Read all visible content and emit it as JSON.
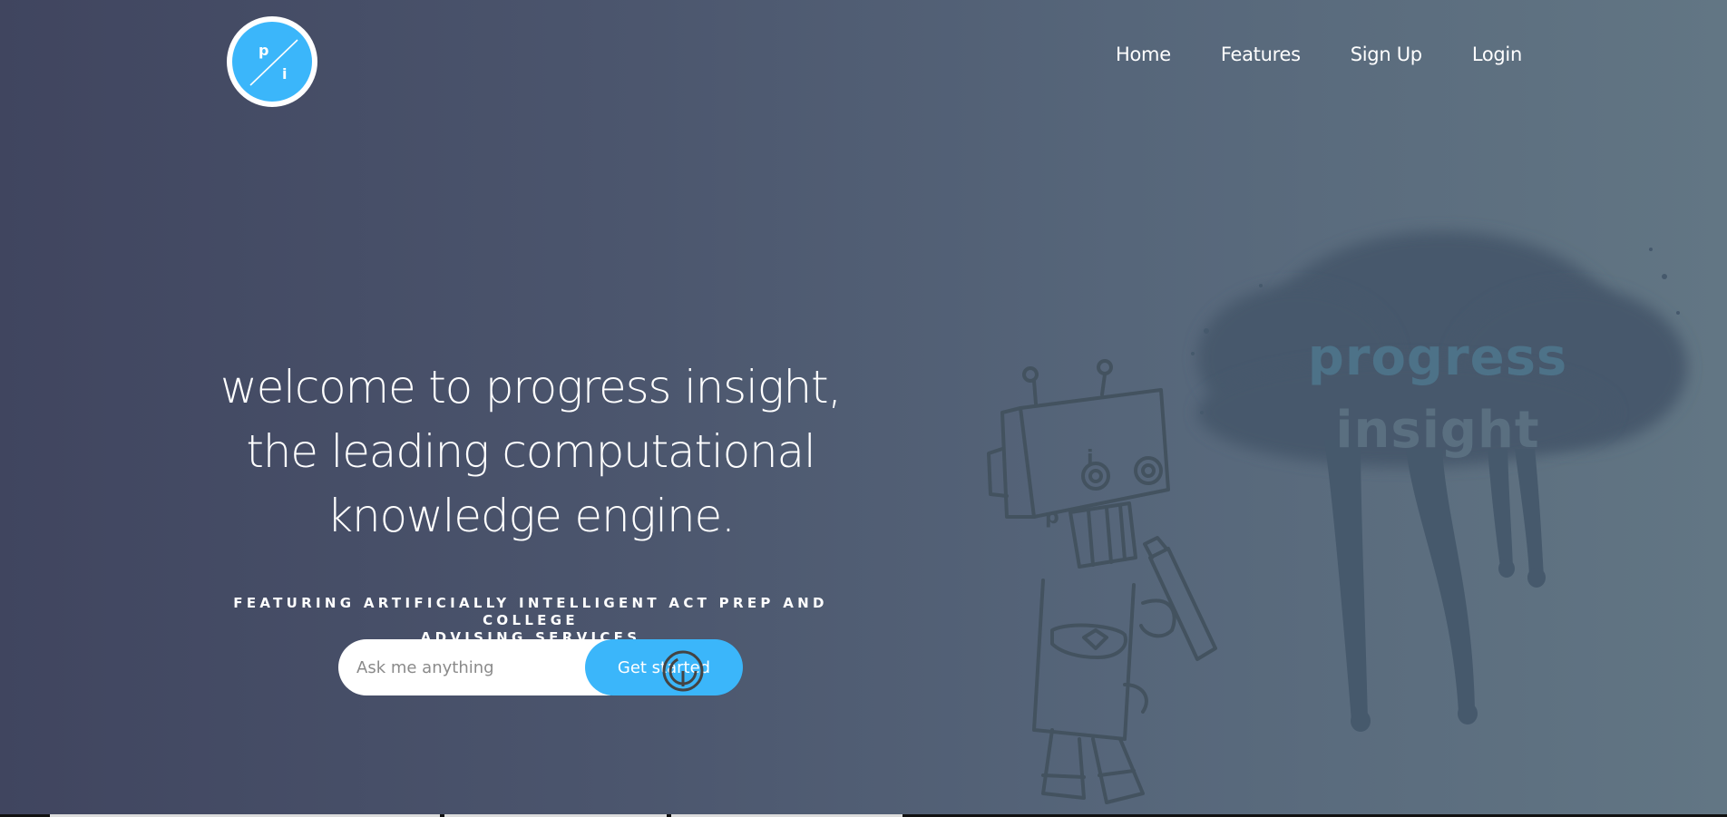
{
  "brand": {
    "logo_letter_top": "p",
    "logo_letter_bottom": "i",
    "accent": "#3bb6fa"
  },
  "nav": {
    "home": "Home",
    "features": "Features",
    "signup": "Sign Up",
    "login": "Login"
  },
  "hero": {
    "line1": "welcome to progress insight,",
    "line2": "the leading computational",
    "line3": "knowledge engine.",
    "subtitle_line1": "FEATURING ARTIFICIALLY INTELLIGENT ACT PREP AND COLLEGE",
    "subtitle_line2": "ADVISING SERVICES"
  },
  "search": {
    "placeholder": "Ask me anything",
    "button_label": "Get started"
  },
  "illustration": {
    "graffiti_line1": "progress",
    "graffiti_line2": "insight",
    "robot_letter_top": "i",
    "robot_letter_bottom": "p"
  }
}
